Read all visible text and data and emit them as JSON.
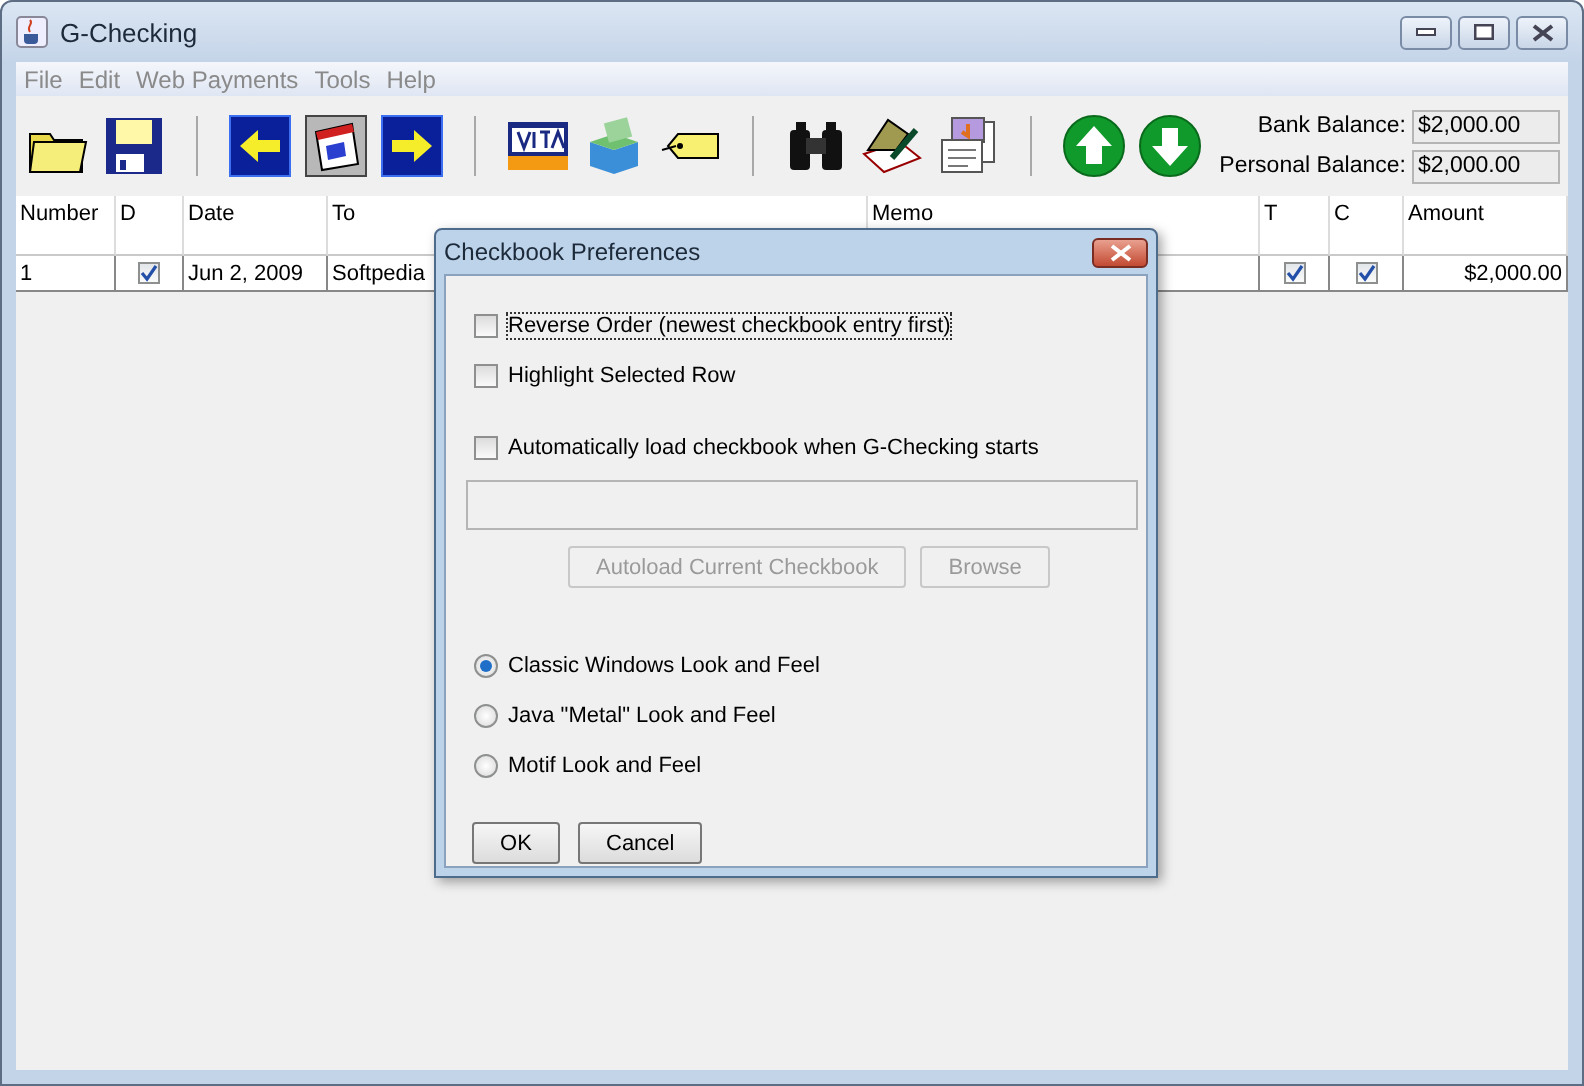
{
  "window": {
    "title": "G-Checking"
  },
  "menu": [
    "File",
    "Edit",
    "Web Payments",
    "Tools",
    "Help"
  ],
  "balances": [
    {
      "label": "Bank Balance:",
      "value": "$2,000.00"
    },
    {
      "label": "Personal Balance:",
      "value": "$2,000.00"
    }
  ],
  "table": {
    "columns": [
      "Number",
      "D",
      "Date",
      "To",
      "Memo",
      "T",
      "C",
      "Amount"
    ],
    "rows": [
      {
        "number": "1",
        "d": true,
        "date": "Jun 2, 2009",
        "to": "Softpedia",
        "t": true,
        "c": true,
        "amount": "$2,000.00"
      }
    ]
  },
  "dialog": {
    "title": "Checkbook Preferences",
    "options": [
      {
        "label": "Reverse Order (newest checkbook entry first)",
        "checked": false,
        "focused": true
      },
      {
        "label": "Highlight Selected Row",
        "checked": false,
        "focused": false
      }
    ],
    "autoload": {
      "label": "Automatically load checkbook when G-Checking starts",
      "checked": false
    },
    "autoload_buttons": [
      {
        "label": "Autoload Current Checkbook",
        "disabled": true
      },
      {
        "label": "Browse",
        "disabled": true
      }
    ],
    "look_and_feel": [
      {
        "label": "Classic Windows Look and Feel",
        "selected": true
      },
      {
        "label": "Java \"Metal\" Look and Feel",
        "selected": false
      },
      {
        "label": "Motif Look and Feel",
        "selected": false
      }
    ],
    "actions": [
      "OK",
      "Cancel"
    ]
  }
}
